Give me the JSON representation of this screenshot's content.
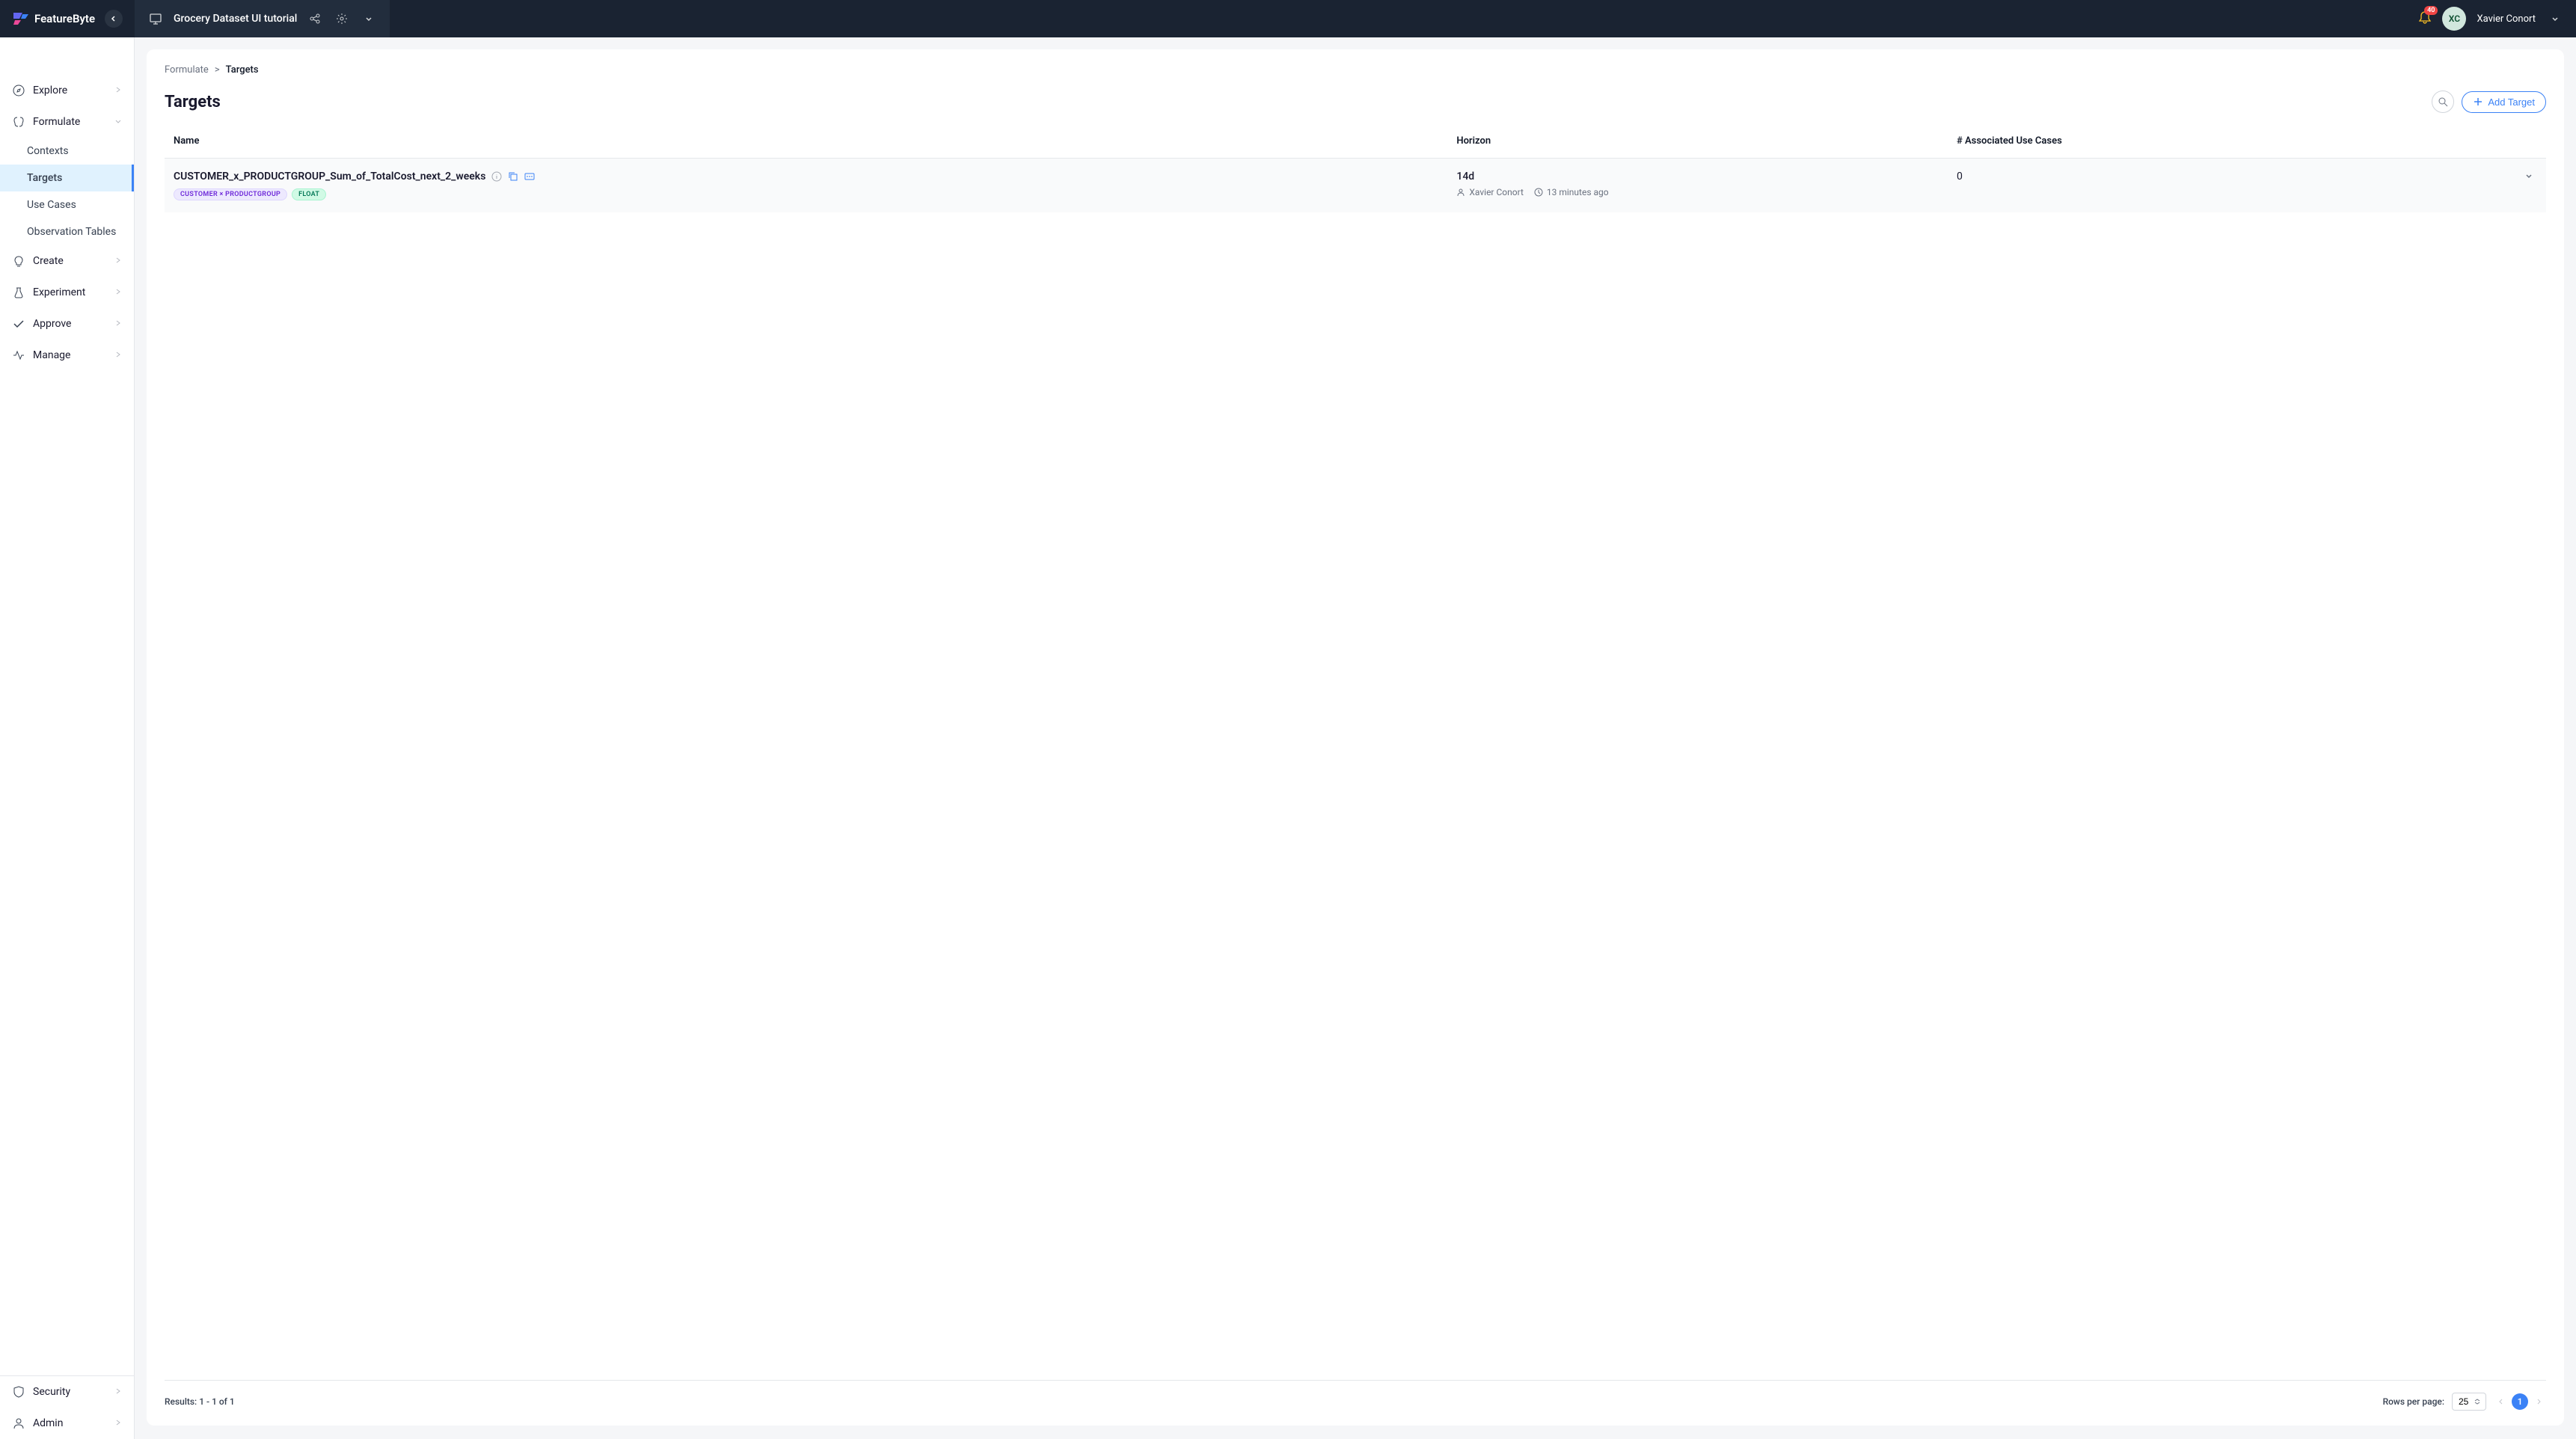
{
  "header": {
    "brand": "FeatureByte",
    "tutorial_name": "Grocery Dataset UI tutorial",
    "notification_count": "40",
    "user_initials": "XC",
    "user_name": "Xavier Conort"
  },
  "sidebar": {
    "main": [
      {
        "label": "Explore",
        "expanded": false
      },
      {
        "label": "Formulate",
        "expanded": true,
        "children": [
          {
            "label": "Contexts",
            "active": false
          },
          {
            "label": "Targets",
            "active": true
          },
          {
            "label": "Use Cases",
            "active": false
          },
          {
            "label": "Observation Tables",
            "active": false
          }
        ]
      },
      {
        "label": "Create",
        "expanded": false
      },
      {
        "label": "Experiment",
        "expanded": false
      },
      {
        "label": "Approve",
        "expanded": false
      },
      {
        "label": "Manage",
        "expanded": false
      }
    ],
    "footer": [
      {
        "label": "Security"
      },
      {
        "label": "Admin"
      }
    ]
  },
  "breadcrumb": {
    "parent": "Formulate",
    "separator": ">",
    "current": "Targets"
  },
  "page": {
    "title": "Targets",
    "add_button": "Add Target"
  },
  "table": {
    "columns": {
      "name": "Name",
      "horizon": "Horizon",
      "associated": "# Associated Use Cases"
    },
    "rows": [
      {
        "name": "CUSTOMER_x_PRODUCTGROUP_Sum_of_TotalCost_next_2_weeks",
        "tag_entity": "CUSTOMER × PRODUCTGROUP",
        "tag_type": "FLOAT",
        "horizon": "14d",
        "author": "Xavier Conort",
        "time_ago": "13 minutes ago",
        "associated_count": "0"
      }
    ]
  },
  "footer": {
    "results": "Results: 1 - 1 of 1",
    "rows_label": "Rows per page:",
    "rows_value": "25",
    "current_page": "1"
  }
}
